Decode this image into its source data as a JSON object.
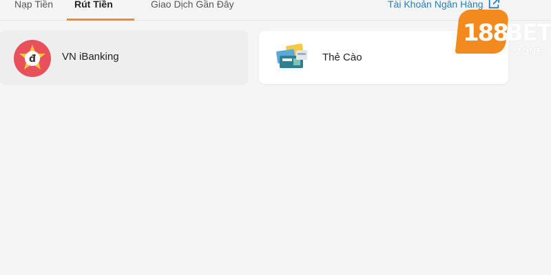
{
  "tabs": [
    {
      "label": "Nạp Tiền",
      "active": false
    },
    {
      "label": "Rút Tiền",
      "active": true
    },
    {
      "label": "Giao Dịch Gần Đây",
      "active": false
    }
  ],
  "bank_account_link": {
    "label": "Tài Khoản Ngân Hàng",
    "icon": "external-link-icon"
  },
  "methods": [
    {
      "label": "VN iBanking",
      "icon": "dong-coin-icon",
      "selected": true
    },
    {
      "label": "Thẻ Cào",
      "icon": "scratch-card-icon",
      "selected": false
    }
  ],
  "logo": {
    "number": "188",
    "brand": "BET",
    "suffix": ".ZONE"
  },
  "colors": {
    "accent": "#f28a1e",
    "link": "#1f7fc2",
    "coin_red": "#e8505b",
    "background": "#f5f5f5"
  }
}
